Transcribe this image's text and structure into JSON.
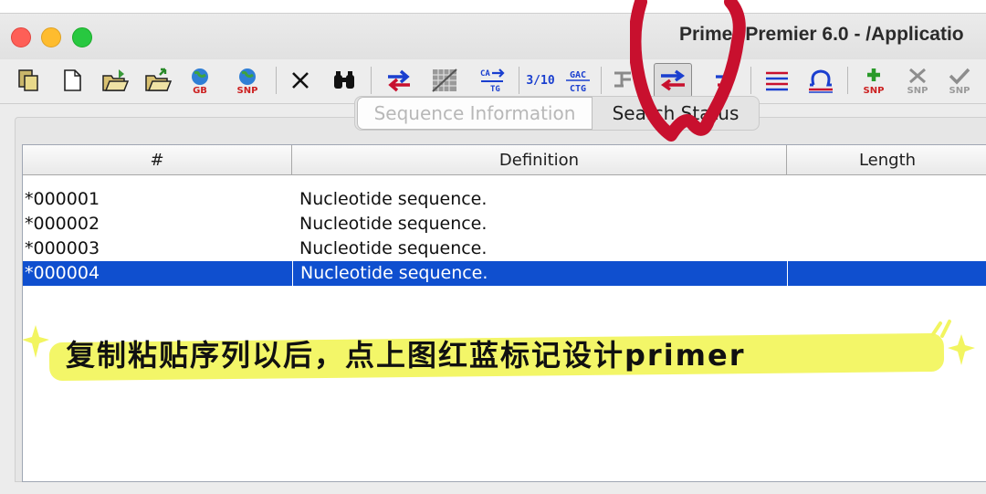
{
  "window": {
    "title": "Primer Premier 6.0 - /Applicatio"
  },
  "toolbar": {
    "items": [
      {
        "name": "paste-icon"
      },
      {
        "name": "new-document-icon"
      },
      {
        "name": "open-folder-icon"
      },
      {
        "name": "export-folder-icon"
      },
      {
        "name": "genbank-globe-icon",
        "label": "GB"
      },
      {
        "name": "snp-globe-icon",
        "label": "SNP"
      },
      {
        "name": "delete-x-icon"
      },
      {
        "name": "binoculars-search-icon"
      },
      {
        "name": "swap-arrows-icon"
      },
      {
        "name": "alignment-grid-icon"
      },
      {
        "name": "sequence-convert-icon",
        "label_top": "CA",
        "label_bottom": "TG"
      },
      {
        "name": "fraction-icon",
        "label": "3/10"
      },
      {
        "name": "sequence-text-icon",
        "label_top": "GAC",
        "label_bottom": "CTG"
      },
      {
        "name": "tree-icon"
      },
      {
        "name": "design-primer-arrows-icon"
      },
      {
        "name": "primer-arrows-icon"
      },
      {
        "name": "lines-icon"
      },
      {
        "name": "omega-icon"
      },
      {
        "name": "snp-add-icon",
        "label": "SNP"
      },
      {
        "name": "snp-remove-icon",
        "label": "SNP"
      },
      {
        "name": "snp-check-icon",
        "label": "SNP"
      }
    ]
  },
  "tabs": [
    {
      "label": "Sequence Information",
      "active": false
    },
    {
      "label": "Search Status",
      "active": true
    }
  ],
  "table": {
    "columns": [
      "#",
      "Definition",
      "Length"
    ],
    "rows": [
      {
        "id": "*000001",
        "definition": "Nucleotide sequence.",
        "length": "",
        "selected": false
      },
      {
        "id": "*000002",
        "definition": "Nucleotide sequence.",
        "length": "",
        "selected": false
      },
      {
        "id": "*000003",
        "definition": "Nucleotide sequence.",
        "length": "",
        "selected": false
      },
      {
        "id": "*000004",
        "definition": "Nucleotide sequence.",
        "length": "",
        "selected": true
      }
    ]
  },
  "annotation": {
    "text": "复制粘贴序列以后，点上图红蓝标记设计primer",
    "highlight_color": "#f2f560",
    "marker_color": "#c8102e"
  },
  "colors": {
    "selection": "#0f4fcf",
    "accent_red": "#c8102e",
    "accent_blue": "#1a3fcf"
  }
}
